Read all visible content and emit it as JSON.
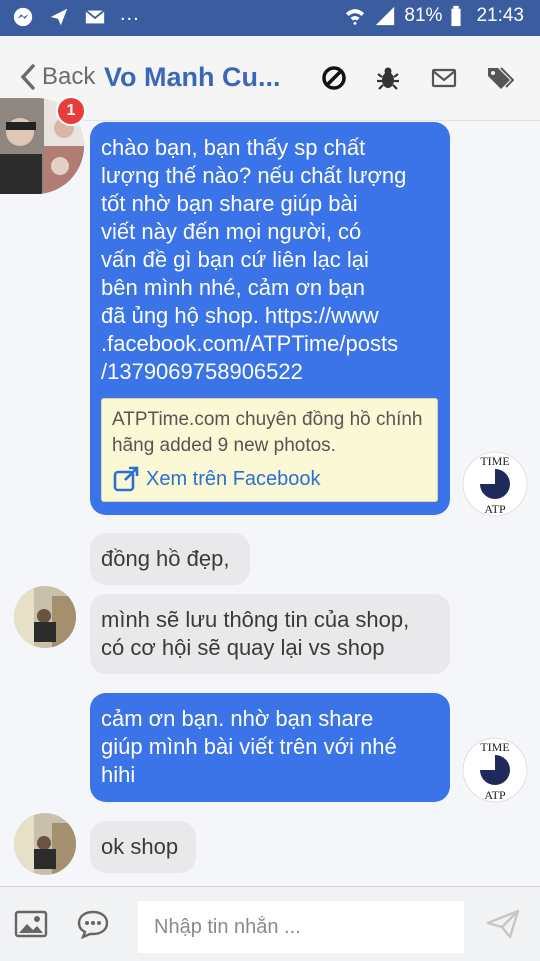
{
  "status_bar": {
    "dots": "...",
    "battery_percent": "81%",
    "time": "21:43",
    "icons": [
      "messenger-icon",
      "send-icon",
      "mail-icon",
      "wifi-icon",
      "signal-icon",
      "battery-icon"
    ]
  },
  "header": {
    "back_label": "Back",
    "contact_name": "Vo Manh Cu...",
    "icons": [
      "block-icon",
      "bug-icon",
      "mail-icon",
      "tag-icon"
    ]
  },
  "contact_avatar": {
    "badge_count": "1"
  },
  "messages": [
    {
      "direction": "out",
      "text": "chào bạn, bạn thấy sp chất\nlượng thế nào? nếu chất lượng\ntốt nhờ bạn share giúp bài\nviết này đến mọi người, có\nvấn đề gì bạn cứ liên lạc lại\nbên mình nhé, cảm ơn bạn\nđã ủng hộ shop. https://www\n.facebook.com/ATPTime/posts\n/1379069758906522",
      "card_text": "ATPTime.com chuyên đồng hồ chính hãng added 9 new photos.",
      "card_link": "Xem trên Facebook"
    },
    {
      "direction": "in",
      "text": "đồng hồ đẹp,"
    },
    {
      "direction": "in",
      "text": "mình sẽ lưu thông tin của shop,\ncó cơ hội sẽ quay lại vs shop"
    },
    {
      "direction": "out",
      "text": "cảm ơn bạn. nhờ bạn share\ngiúp mình bài viết trên với nhé\nhihi"
    },
    {
      "direction": "in",
      "text": "ok shop"
    }
  ],
  "shop_logo_text": "TIME ATP",
  "composer": {
    "placeholder": "Nhập tin nhắn ...",
    "value": ""
  },
  "colors": {
    "status_bar": "#3b5c9e",
    "outgoing_bubble": "#3b74e8",
    "incoming_bubble": "#e9e9ec",
    "contact_name": "#3a67b8",
    "badge": "#e83b3b",
    "link_card": "#fbf8d6"
  }
}
